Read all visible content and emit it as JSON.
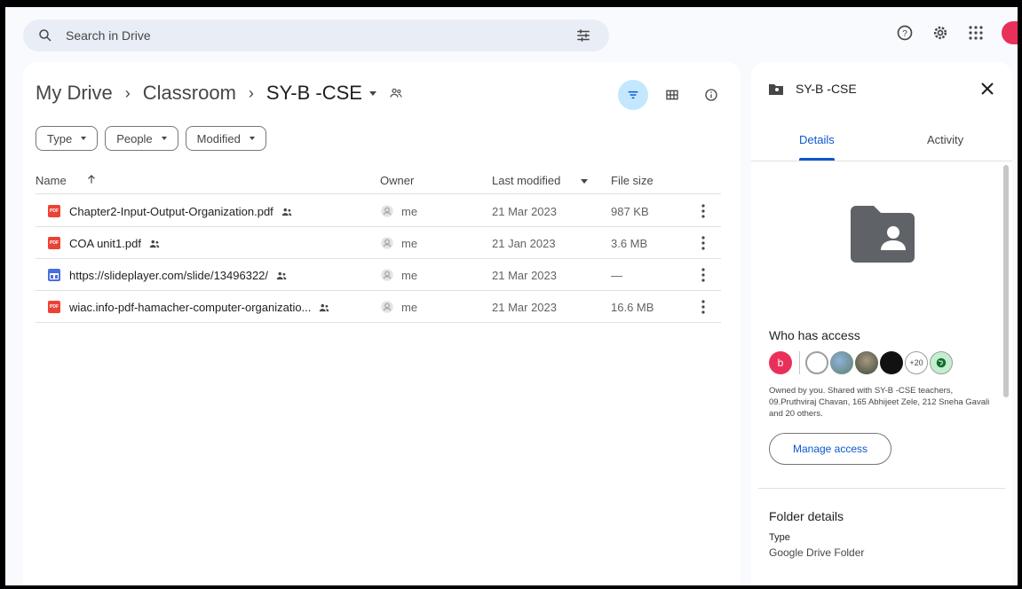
{
  "search": {
    "placeholder": "Search in Drive",
    "icon": "search-icon",
    "filter_icon": "tune-icon"
  },
  "top_right": {
    "help_icon": "help-icon",
    "settings_icon": "gear-icon",
    "apps_icon": "apps-grid-icon"
  },
  "breadcrumb": {
    "items": [
      "My Drive",
      "Classroom",
      "SY-B -CSE"
    ],
    "separator": "›"
  },
  "filters": {
    "type": "Type",
    "people": "People",
    "modified": "Modified"
  },
  "table": {
    "headers": {
      "name": "Name",
      "owner": "Owner",
      "last_modified": "Last modified",
      "file_size": "File size"
    },
    "rows": [
      {
        "name": "Chapter2-Input-Output-Organization.pdf",
        "type": "pdf",
        "owner": "me",
        "modified": "21 Mar 2023",
        "size": "987 KB"
      },
      {
        "name": "COA unit1.pdf",
        "type": "pdf",
        "owner": "me",
        "modified": "21 Jan 2023",
        "size": "3.6 MB"
      },
      {
        "name": "https://slideplayer.com/slide/13496322/",
        "type": "site",
        "owner": "me",
        "modified": "21 Mar 2023",
        "size": "—"
      },
      {
        "name": "wiac.info-pdf-hamacher-computer-organizatio...",
        "type": "pdf",
        "owner": "me",
        "modified": "21 Mar 2023",
        "size": "16.6 MB"
      }
    ]
  },
  "details": {
    "title": "SY-B -CSE",
    "tabs": [
      "Details",
      "Activity"
    ],
    "who_has_access": "Who has access",
    "avatar_initial": "b",
    "more_count": "+20",
    "owned_text": "Owned by you. Shared with SY-B -CSE teachers, 09.Pruthviraj Chavan, 165 Abhijeet Zele, 212 Sneha Gavali and 20 others.",
    "manage_access": "Manage access",
    "folder_details": "Folder details",
    "type_label": "Type",
    "type_value": "Google Drive Folder"
  },
  "colors": {
    "accent": "#0b57d0",
    "pdf_red": "#ea4335",
    "active_filter": "#c2e7ff"
  }
}
